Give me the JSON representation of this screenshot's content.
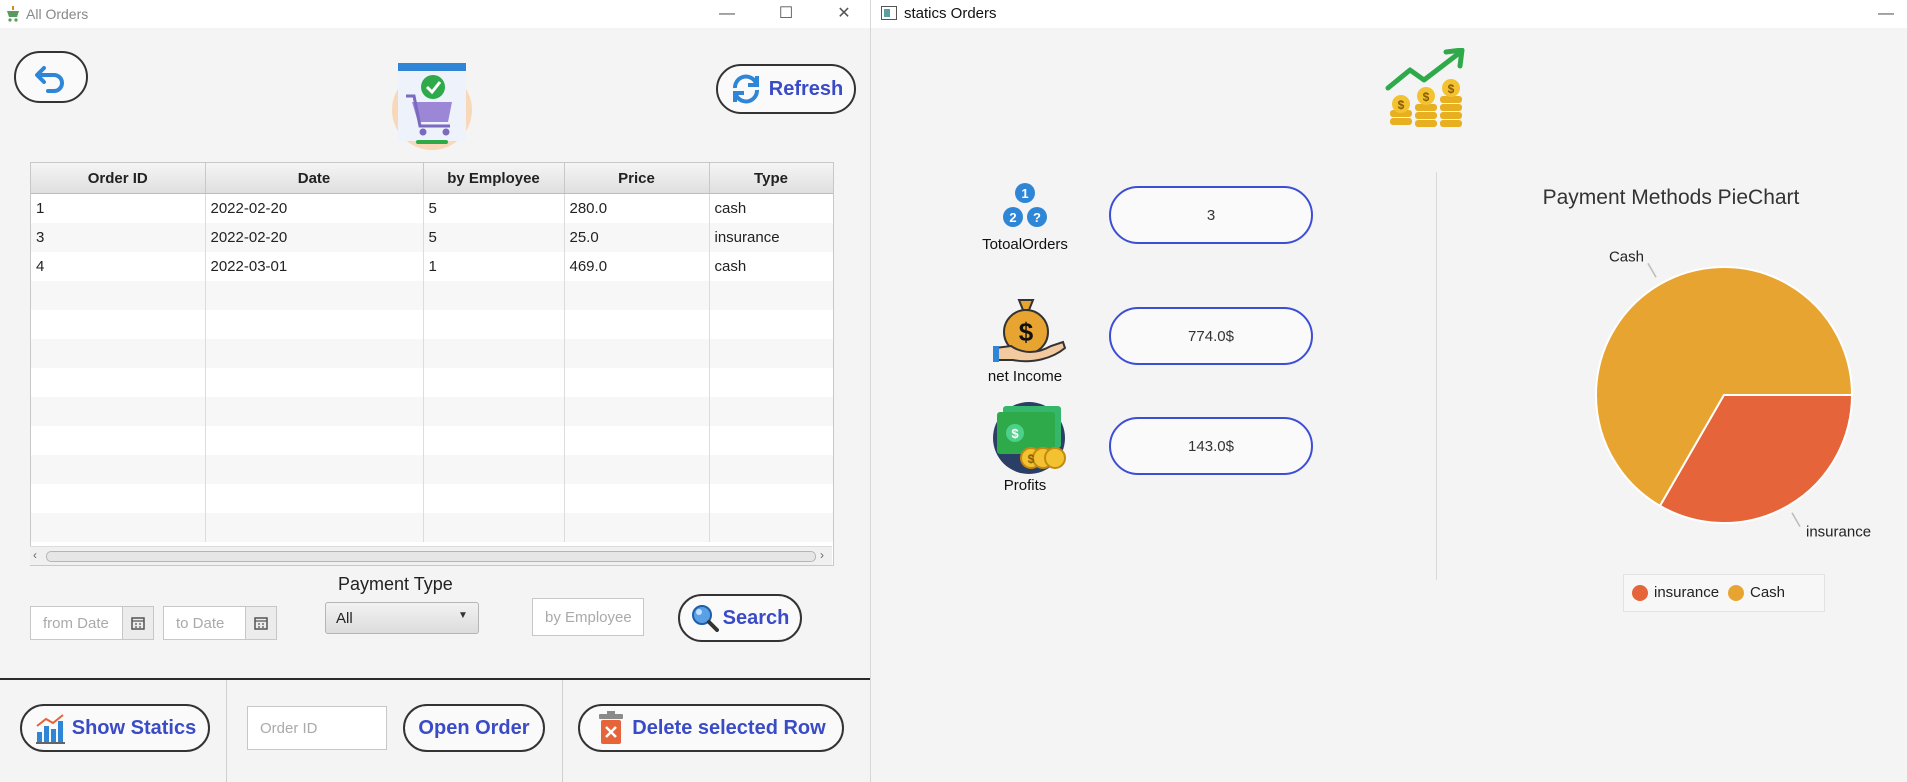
{
  "left_window": {
    "title": "All Orders",
    "refresh_label": "Refresh",
    "table": {
      "columns": [
        "Order ID",
        "Date",
        "by Employee",
        "Price",
        "Type"
      ],
      "rows": [
        [
          "1",
          "2022-02-20",
          "5",
          "280.0",
          "cash"
        ],
        [
          "3",
          "2022-02-20",
          "5",
          "25.0",
          "insurance"
        ],
        [
          "4",
          "2022-03-01",
          "1",
          "469.0",
          "cash"
        ]
      ]
    },
    "filters": {
      "from_date_placeholder": "from Date",
      "to_date_placeholder": "to Date",
      "payment_type_label": "Payment Type",
      "payment_type_value": "All",
      "employee_placeholder": "by Employee",
      "search_label": "Search"
    },
    "bottom": {
      "show_statics_label": "Show Statics",
      "order_id_placeholder": "Order ID",
      "open_order_label": "Open Order",
      "delete_label": "Delete selected Row"
    }
  },
  "right_window": {
    "title": "statics Orders",
    "total_orders_label": "TotoalOrders",
    "total_orders_value": "3",
    "net_income_label": "net Income",
    "net_income_value": "774.0$",
    "profits_label": "Profits",
    "profits_value": "143.0$"
  },
  "chart_data": {
    "type": "pie",
    "title": "Payment Methods PieChart",
    "slices": [
      {
        "name": "Cash",
        "value": 2,
        "color": "#e8a430"
      },
      {
        "name": "insurance",
        "value": 1,
        "color": "#e5643a"
      }
    ],
    "legend": [
      "insurance",
      "Cash"
    ],
    "legend_position": "bottom"
  },
  "colors": {
    "button_text": "#3a4bc7",
    "value_box_border": "#3d4ed6",
    "pie_cash": "#e8a430",
    "pie_insurance": "#e5643a"
  }
}
